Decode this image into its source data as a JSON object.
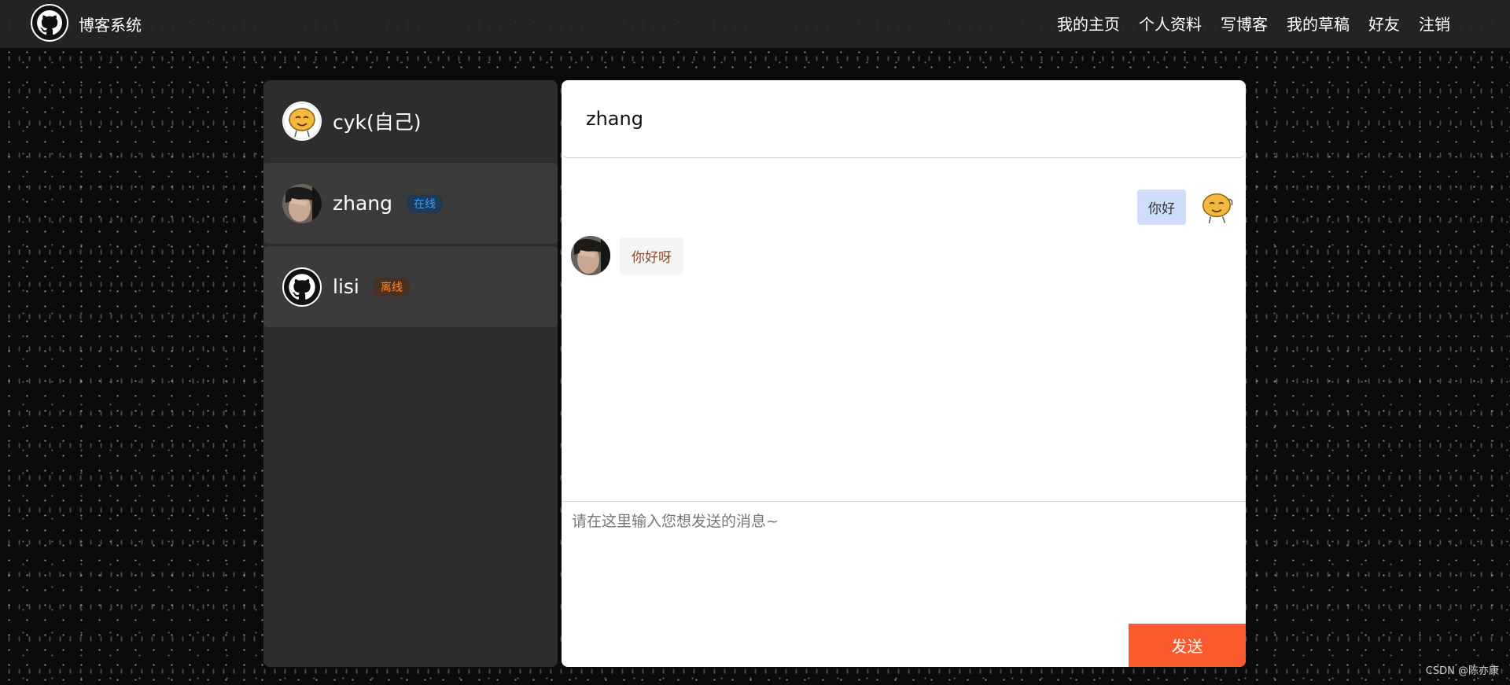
{
  "nav": {
    "brand": "博客系统",
    "links": [
      "我的主页",
      "个人资料",
      "写博客",
      "我的草稿",
      "好友",
      "注销"
    ]
  },
  "left_panel": {
    "self": {
      "name": "cyk(自己)"
    },
    "friends": [
      {
        "name": "zhang",
        "status": "在线"
      },
      {
        "name": "lisi",
        "status": "离线"
      }
    ]
  },
  "chat": {
    "header_title": "zhang",
    "messages": [
      {
        "from": "me",
        "text": "你好"
      },
      {
        "from": "zhang",
        "text": "你好呀"
      }
    ],
    "input_placeholder": "请在这里输入您想发送的消息~",
    "input_value": "",
    "send_label": "发送"
  },
  "watermark": "CSDN @陈亦康",
  "colors": {
    "send_button": "#fb5a2f",
    "online_badge": "#3aa0ff",
    "offline_badge": "#ff8a2a",
    "my_bubble": "#cfdcfb",
    "panel_bg": "#2d2d2d"
  },
  "icons": {
    "brand": "github-icon",
    "self_avatar": "smiley-avatar-icon",
    "lisi_avatar": "github-icon"
  }
}
